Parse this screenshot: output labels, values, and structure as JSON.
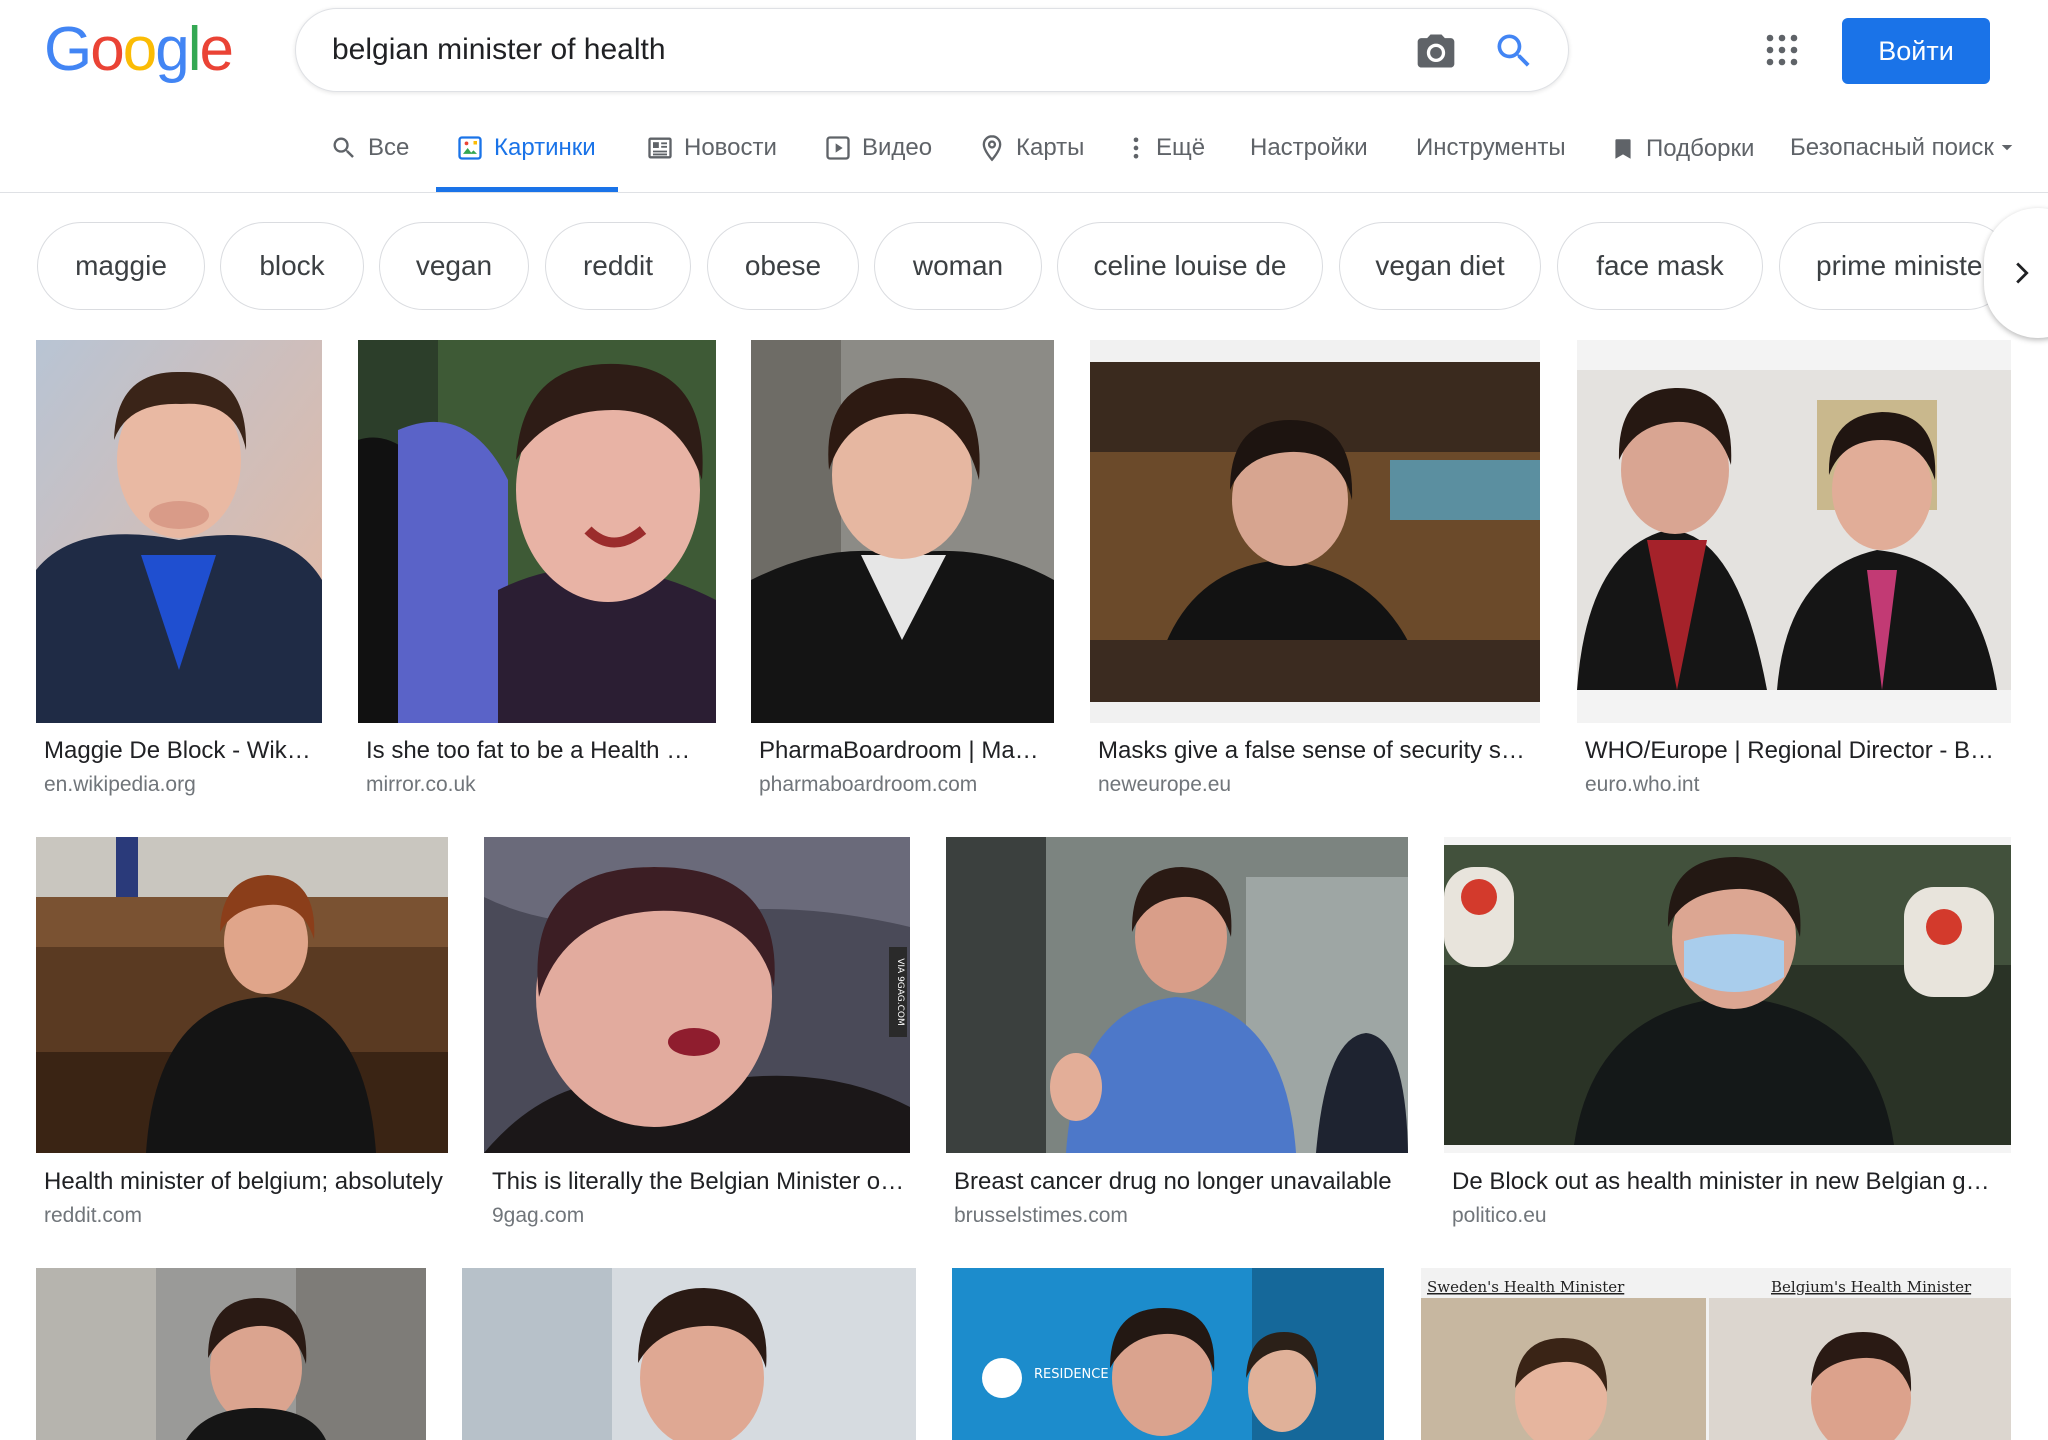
{
  "logo": [
    "G",
    "o",
    "o",
    "g",
    "l",
    "e"
  ],
  "search": {
    "query": "belgian minister of health"
  },
  "header": {
    "signin_label": "Войти"
  },
  "tabs": [
    {
      "label": "Все",
      "icon": "search-icon"
    },
    {
      "label": "Картинки",
      "icon": "image-icon",
      "active": true
    },
    {
      "label": "Новости",
      "icon": "newspaper-icon"
    },
    {
      "label": "Видео",
      "icon": "play-icon"
    },
    {
      "label": "Карты",
      "icon": "map-pin-icon"
    },
    {
      "label": "Ещё",
      "icon": "more-vert-icon"
    }
  ],
  "tools": {
    "settings": "Настройки",
    "instruments": "Инструменты",
    "collections": "Подборки",
    "safe_search": "Безопасный поиск"
  },
  "chips": [
    "maggie",
    "block",
    "vegan",
    "reddit",
    "obese",
    "woman",
    "celine louise de",
    "vegan diet",
    "face mask",
    "prime ministe"
  ],
  "results": [
    {
      "title": "Maggie De Block - Wikipedia",
      "source": "en.wikipedia.org"
    },
    {
      "title": "Is she too fat to be a Health Minister",
      "source": "mirror.co.uk"
    },
    {
      "title": "PharmaBoardroom | Maggie De Block",
      "source": "pharmaboardroom.com"
    },
    {
      "title": "Masks give a false sense of security says",
      "source": "neweurope.eu"
    },
    {
      "title": "WHO/Europe | Regional Director - Belgium",
      "source": "euro.who.int"
    },
    {
      "title": "Health minister of belgium; absolutely",
      "source": "reddit.com"
    },
    {
      "title": "This is literally the Belgian Minister of Health",
      "source": "9gag.com"
    },
    {
      "title": "Breast cancer drug no longer unavailable",
      "source": "brusselstimes.com"
    },
    {
      "title": "De Block out as health minister in new Belgian government",
      "source": "politico.eu"
    }
  ],
  "thumb_overlays": {
    "vertical_watermark": "VIA 9GAG.COM",
    "residence_palace": "RESIDENCE PALACE",
    "sweden_caption": "Sweden's Health Minister",
    "belgium_caption": "Belgium's Health Minister"
  }
}
